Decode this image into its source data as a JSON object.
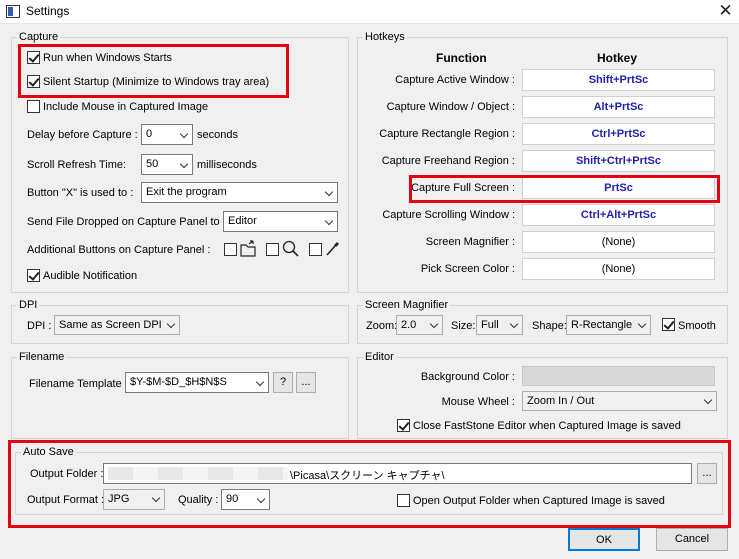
{
  "window": {
    "title": "Settings"
  },
  "capture": {
    "legend": "Capture",
    "run_when_windows_starts": "Run when Windows Starts",
    "silent_startup": "Silent Startup (Minimize to Windows tray area)",
    "include_mouse": "Include Mouse in Captured Image",
    "delay_label": "Delay before Capture :",
    "delay_value": "0",
    "delay_unit": "seconds",
    "scroll_label": "Scroll Refresh Time:",
    "scroll_value": "50",
    "scroll_unit": "milliseconds",
    "button_x_label": "Button \"X\" is used to :",
    "button_x_value": "Exit the program",
    "send_file_label": "Send File Dropped on Capture Panel to :",
    "send_file_value": "Editor",
    "additional_label": "Additional Buttons on Capture Panel :",
    "audible": "Audible Notification",
    "checked": {
      "run": true,
      "silent": true,
      "mouse": false,
      "audible": true
    }
  },
  "hotkeys": {
    "legend": "Hotkeys",
    "col_function": "Function",
    "col_hotkey": "Hotkey",
    "rows": [
      {
        "label": "Capture Active Window :",
        "key": "Shift+PrtSc",
        "active": true
      },
      {
        "label": "Capture Window / Object :",
        "key": "Alt+PrtSc",
        "active": true
      },
      {
        "label": "Capture Rectangle Region :",
        "key": "Ctrl+PrtSc",
        "active": true
      },
      {
        "label": "Capture Freehand Region :",
        "key": "Shift+Ctrl+PrtSc",
        "active": true
      },
      {
        "label": "Capture Full Screen :",
        "key": "PrtSc",
        "active": true
      },
      {
        "label": "Capture Scrolling Window :",
        "key": "Ctrl+Alt+PrtSc",
        "active": true
      },
      {
        "label": "Screen Magnifier :",
        "key": "(None)",
        "active": false
      },
      {
        "label": "Pick Screen Color :",
        "key": "(None)",
        "active": false
      }
    ]
  },
  "dpi": {
    "legend": "DPI",
    "label": "DPI :",
    "value": "Same as Screen DPI"
  },
  "magnifier": {
    "legend": "Screen Magnifier",
    "zoom_label": "Zoom:",
    "zoom_value": "2.0",
    "size_label": "Size:",
    "size_value": "Full",
    "shape_label": "Shape:",
    "shape_value": "R-Rectangle",
    "smooth": "Smooth",
    "smooth_checked": true
  },
  "filename": {
    "legend": "Filename",
    "label": "Filename Template :",
    "value": "$Y-$M-$D_$H$N$S",
    "help": "?",
    "more": "..."
  },
  "editor": {
    "legend": "Editor",
    "bg_label": "Background Color :",
    "wheel_label": "Mouse Wheel :",
    "wheel_value": "Zoom In / Out",
    "close_editor": "Close FastStone Editor when Captured Image is saved",
    "close_checked": true
  },
  "autosave": {
    "legend": "Auto Save",
    "folder_label": "Output Folder :",
    "folder_value": "\\Picasa\\スクリーン キャプチャ\\",
    "browse": "...",
    "format_label": "Output Format :",
    "format_value": "JPG",
    "quality_label": "Quality :",
    "quality_value": "90",
    "open_folder": "Open Output Folder when Captured Image is saved",
    "open_checked": false
  },
  "buttons": {
    "ok": "OK",
    "cancel": "Cancel"
  },
  "colors": {
    "highlight": "#e60012",
    "hotkey_text": "#1f1fb0",
    "ok_border": "#0078d7"
  }
}
